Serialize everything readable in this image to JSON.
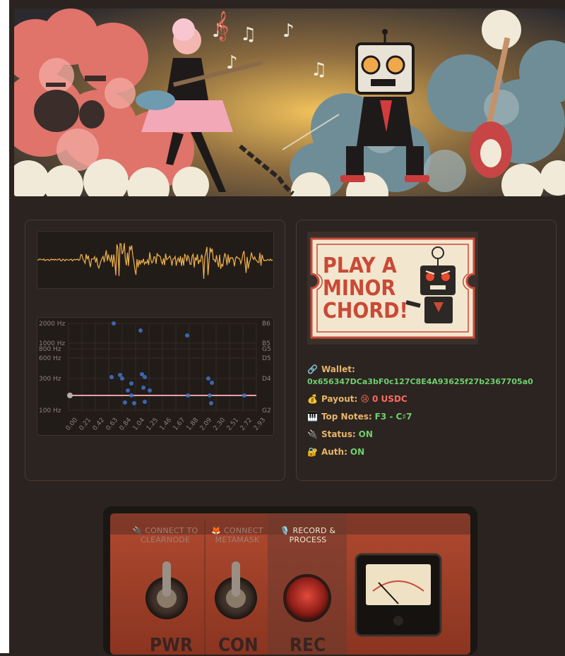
{
  "waveform": {
    "color": "#f0b24a"
  },
  "pitch_chart": {
    "freq_labels": [
      "2000 Hz",
      "1000 Hz",
      "800 Hz",
      "600 Hz",
      "300 Hz",
      "100 Hz"
    ],
    "note_labels": [
      "B6",
      "B5",
      "G5",
      "D5",
      "D4",
      "G2"
    ],
    "time_ticks": [
      "0.00",
      "0.21",
      "0.42",
      "0.63",
      "0.84",
      "1.04",
      "1.25",
      "1.46",
      "1.67",
      "1.88",
      "2.09",
      "2.30",
      "2.51",
      "2.72",
      "2.93"
    ]
  },
  "ticket": {
    "lines": [
      "PLAY A",
      "MINOR",
      "CHORD!"
    ]
  },
  "info": {
    "wallet_label": "Wallet:",
    "wallet_address": "0x656347DCa3bF0c127C8E4A93625f27b2367705a0",
    "payout_label": "Payout:",
    "payout_value": "😢 0 USDC",
    "notes_label": "Top Notes:",
    "notes_value": "F3 - C♯7",
    "status_label": "Status:",
    "status_value": "ON",
    "auth_label": "Auth:",
    "auth_value": "ON"
  },
  "icons": {
    "wallet": "🔗",
    "payout": "💰",
    "notes": "🎹",
    "status": "🔌",
    "auth": "🔐",
    "mic": "🎙️",
    "plug": "🔌",
    "fox": "🦊"
  },
  "controls": {
    "connect_clearnode_label": "CONNECT TO CLEARNODE",
    "connect_metamask_label": "CONNECT METAMASK",
    "record_label": "RECORD & PROCESS",
    "pwr_label": "PWR",
    "con_label": "CON",
    "rec_label": "REC"
  }
}
